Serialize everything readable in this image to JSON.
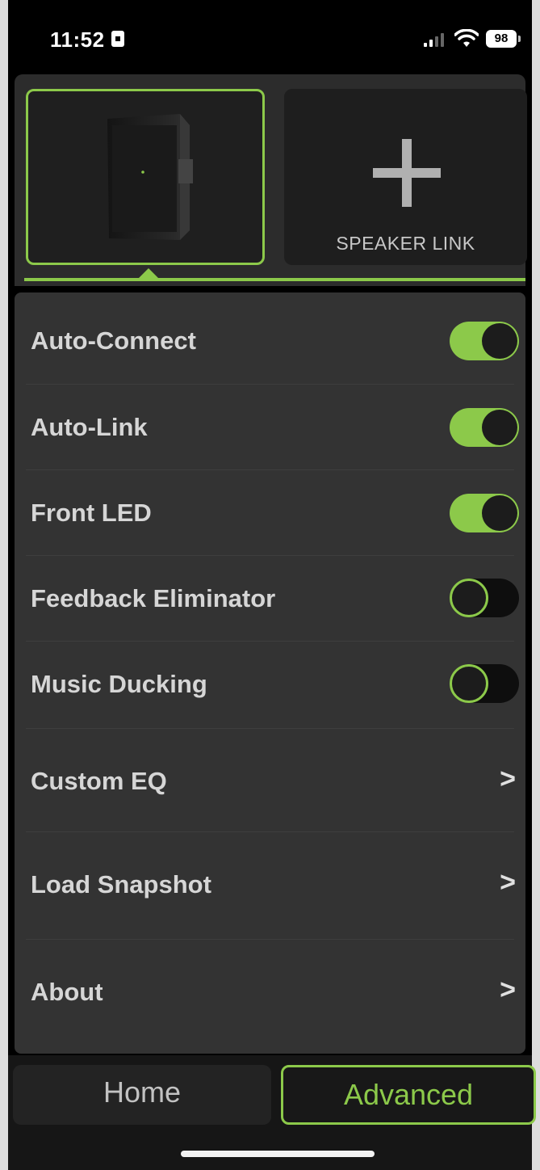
{
  "status_bar": {
    "time": "11:52",
    "battery": "98"
  },
  "speakers": {
    "add_label": "SPEAKER LINK"
  },
  "settings": {
    "toggles": [
      {
        "label": "Auto-Connect",
        "state": "on"
      },
      {
        "label": "Auto-Link",
        "state": "on"
      },
      {
        "label": "Front LED",
        "state": "on"
      },
      {
        "label": "Feedback Eliminator",
        "state": "off"
      },
      {
        "label": "Music Ducking",
        "state": "off"
      }
    ],
    "links": [
      {
        "label": "Custom EQ",
        "chevron": ">"
      },
      {
        "label": "Load Snapshot",
        "chevron": ">"
      },
      {
        "label": "About",
        "chevron": ">"
      }
    ]
  },
  "bottom_tabs": {
    "home": "Home",
    "advanced": "Advanced",
    "active": "Advanced"
  },
  "colors": {
    "accent": "#8cc94a",
    "panel": "#333333",
    "background": "#000000"
  }
}
